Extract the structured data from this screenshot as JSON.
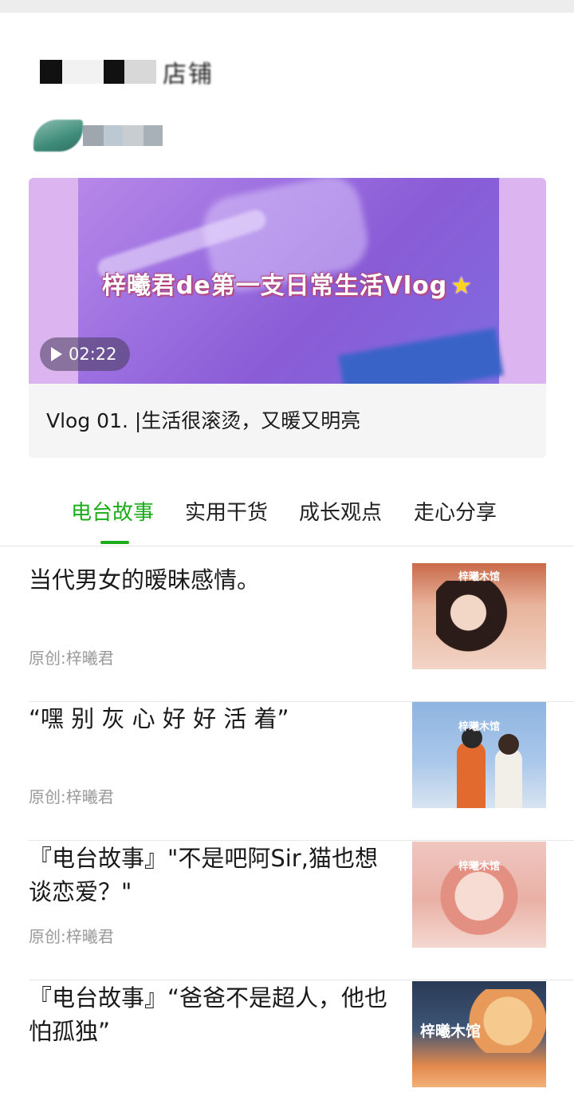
{
  "account": {
    "title_visible_fragment": "店铺"
  },
  "featured_video": {
    "overlay_caption": "梓曦君de第一支日常生活Vlog",
    "duration": "02:22",
    "title": "Vlog 01. |生活很滚烫，又暖又明亮"
  },
  "tabs": [
    {
      "label": "电台故事",
      "active": true
    },
    {
      "label": "实用干货",
      "active": false
    },
    {
      "label": "成长观点",
      "active": false
    },
    {
      "label": "走心分享",
      "active": false
    }
  ],
  "articles": [
    {
      "title": "当代男女的暧昧感情。",
      "meta": "原创:梓曦君",
      "thumb_brand": "梓曦木馆"
    },
    {
      "title": "“嘿 别 灰 心 好 好 活 着”",
      "meta": "原创:梓曦君",
      "thumb_brand": "梓曦木馆"
    },
    {
      "title": "『电台故事』\"不是吧阿Sir,猫也想谈恋爱？\"",
      "meta": "原创:梓曦君",
      "thumb_brand": "梓曦木馆"
    },
    {
      "title": "『电台故事』“爸爸不是超人，他也怕孤独”",
      "meta": "",
      "thumb_brand": "梓曦木馆"
    }
  ],
  "colors": {
    "accent_green": "#1aad19",
    "meta_gray": "#9a9a9a"
  },
  "icons": {
    "play": "play-icon",
    "star": "star-icon"
  }
}
